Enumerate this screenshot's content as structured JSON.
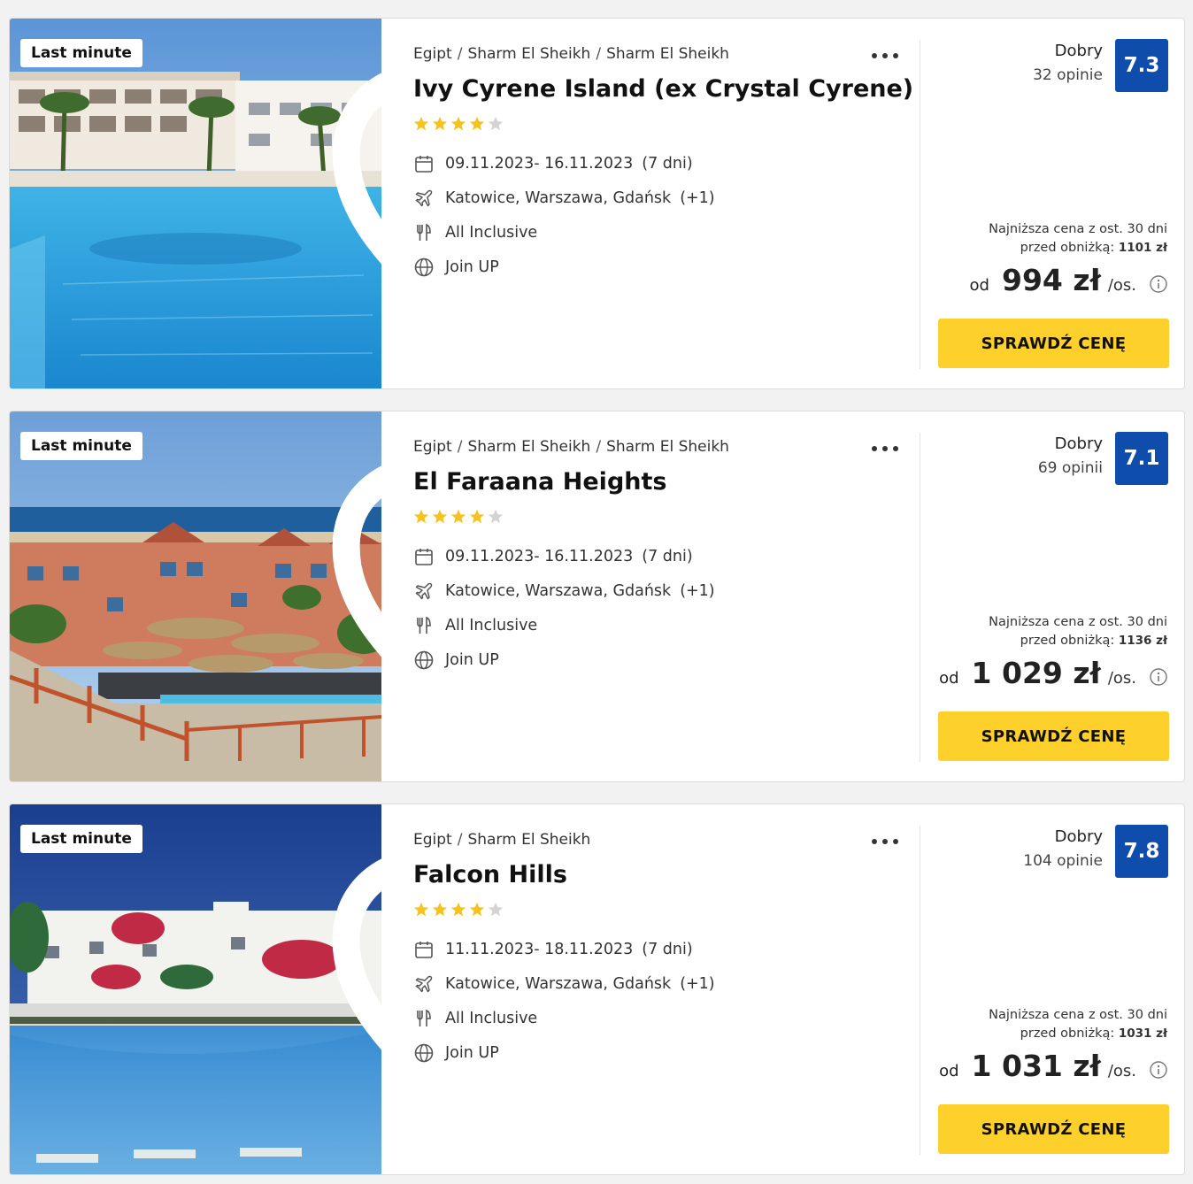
{
  "offers": [
    {
      "badge": "Last minute",
      "breadcrumb": [
        "Egipt",
        "Sharm El Sheikh",
        "Sharm El Sheikh"
      ],
      "title": "Ivy Cyrene Island (ex Crystal Cyrene)",
      "stars": 4,
      "dates": "09.11.2023- 16.11.2023",
      "duration": "(7 dni)",
      "departures": "Katowice, Warszawa, Gdańsk",
      "departures_extra": "(+1)",
      "board": "All Inclusive",
      "operator": "Join UP",
      "rating_label": "Dobry",
      "rating_count": "32 opinie",
      "rating_score": "7.3",
      "lowest_line1": "Najniższa cena z ost. 30 dni",
      "lowest_line2": "przed obniżką:",
      "lowest_price": "1101 zł",
      "price_prefix": "od",
      "price": "994 zł",
      "price_suffix": "/os.",
      "cta": "SPRAWDŹ CENĘ"
    },
    {
      "badge": "Last minute",
      "breadcrumb": [
        "Egipt",
        "Sharm El Sheikh",
        "Sharm El Sheikh"
      ],
      "title": "El Faraana Heights",
      "stars": 4,
      "dates": "09.11.2023- 16.11.2023",
      "duration": "(7 dni)",
      "departures": "Katowice, Warszawa, Gdańsk",
      "departures_extra": "(+1)",
      "board": "All Inclusive",
      "operator": "Join UP",
      "rating_label": "Dobry",
      "rating_count": "69 opinii",
      "rating_score": "7.1",
      "lowest_line1": "Najniższa cena z ost. 30 dni",
      "lowest_line2": "przed obniżką:",
      "lowest_price": "1136 zł",
      "price_prefix": "od",
      "price": "1 029 zł",
      "price_suffix": "/os.",
      "cta": "SPRAWDŹ CENĘ"
    },
    {
      "badge": "Last minute",
      "breadcrumb": [
        "Egipt",
        "Sharm El Sheikh"
      ],
      "title": "Falcon Hills",
      "stars": 4,
      "dates": "11.11.2023- 18.11.2023",
      "duration": "(7 dni)",
      "departures": "Katowice, Warszawa, Gdańsk",
      "departures_extra": "(+1)",
      "board": "All Inclusive",
      "operator": "Join UP",
      "rating_label": "Dobry",
      "rating_count": "104 opinie",
      "rating_score": "7.8",
      "lowest_line1": "Najniższa cena z ost. 30 dni",
      "lowest_line2": "przed obniżką:",
      "lowest_price": "1031 zł",
      "price_prefix": "od",
      "price": "1 031 zł",
      "price_suffix": "/os.",
      "cta": "SPRAWDŹ CENĘ"
    }
  ],
  "colors": {
    "rating_badge": "#0f4dad",
    "cta": "#fdd02c",
    "star_on": "#f6c31c",
    "star_off": "#d3d3d3"
  },
  "icons": {
    "favorite": "heart-outline-icon",
    "more": "more-dots-icon",
    "dates": "calendar-icon",
    "departures": "plane-icon",
    "board": "cutlery-icon",
    "operator": "globe-icon",
    "price_info": "info-circle-icon"
  }
}
